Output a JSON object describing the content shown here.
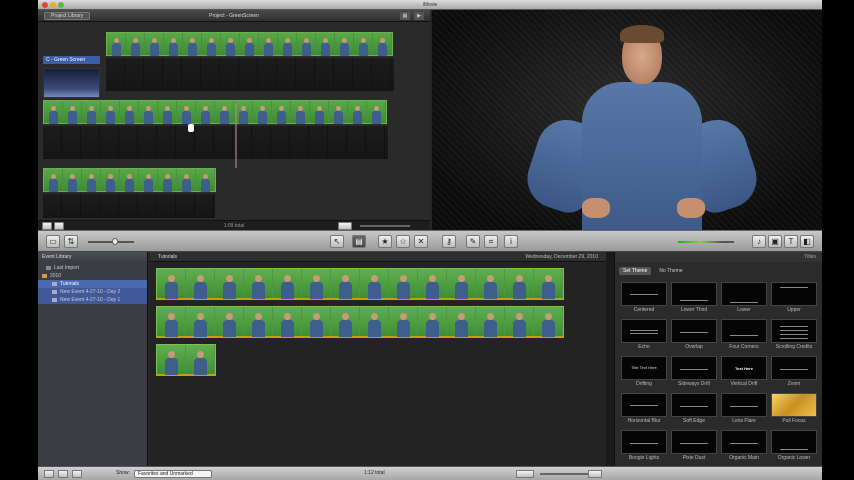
{
  "window": {
    "title": "iMovie"
  },
  "project": {
    "library_button": "Project Library",
    "title": "Project - GreenScreen",
    "clip_label": "C - Green Screen",
    "footer_count": "1:09 total"
  },
  "event_library": {
    "header": "Event Library",
    "items": [
      {
        "label": "Last Import",
        "indent": 1
      },
      {
        "label": "2010",
        "indent": 1
      },
      {
        "label": "Tutorials",
        "indent": 2,
        "selected": true
      },
      {
        "label": "New Event 4-27-10 - Day 2",
        "indent": 2
      },
      {
        "label": "New Event 4-27-10 - Day 1",
        "indent": 2
      }
    ]
  },
  "events": {
    "name": "Tutorials",
    "date": "Wednesday, December 29, 2010"
  },
  "titles": {
    "header": "Titles",
    "tabs": [
      "Set Theme",
      "No Theme"
    ],
    "items": [
      "Centered",
      "Lower Third",
      "Lower",
      "Upper",
      "Echo",
      "Overlap",
      "Four Corners",
      "Scrolling Credits",
      "Drifting",
      "Sideways Drift",
      "Vertical Drift",
      "Zoom",
      "Horizontal Blur",
      "Soft Edge",
      "Lens Flare",
      "Pull Focus",
      "Boogie Lights",
      "Pixie Dust",
      "Organic Main",
      "Organic Lower"
    ],
    "thumb_texts": {
      "text_here": "Text Here",
      "drifting": "Title Text Here"
    }
  },
  "bottom": {
    "show_label": "Show:",
    "show_value": "Favorites and Unmarked",
    "total": "1:12 total"
  }
}
